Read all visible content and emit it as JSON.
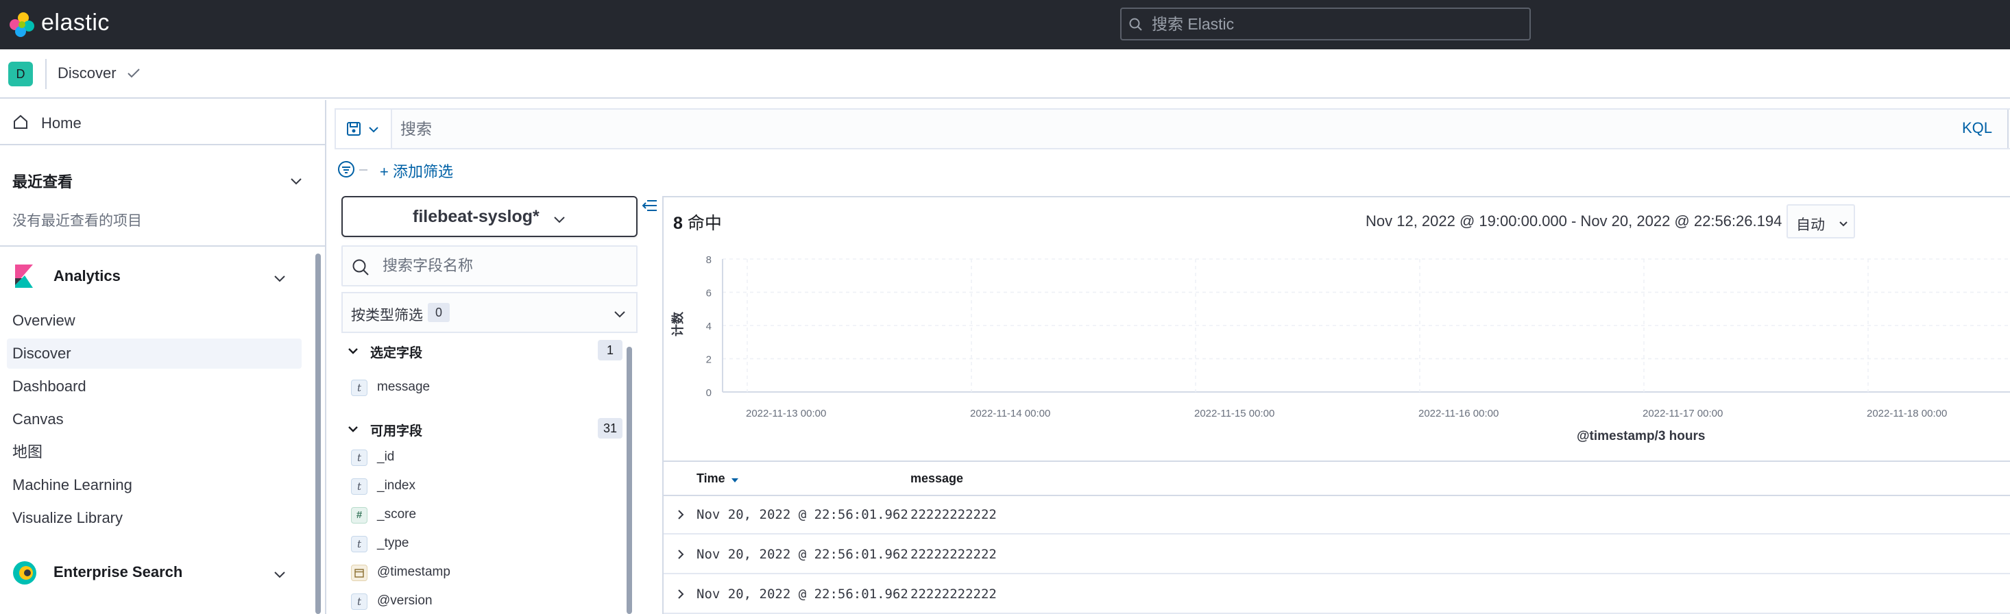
{
  "header": {
    "brand": "elastic",
    "search_placeholder": "搜索 Elastic"
  },
  "breadcrumb": {
    "space_initial": "D",
    "current": "Discover"
  },
  "sidenav": {
    "home_label": "Home",
    "recent_title": "最近查看",
    "recent_empty": "没有最近查看的项目",
    "analytics": {
      "title": "Analytics",
      "items": [
        {
          "label": "Overview",
          "active": false
        },
        {
          "label": "Discover",
          "active": true
        },
        {
          "label": "Dashboard",
          "active": false
        },
        {
          "label": "Canvas",
          "active": false
        },
        {
          "label": "地图",
          "active": false
        },
        {
          "label": "Machine Learning",
          "active": false
        },
        {
          "label": "Visualize Library",
          "active": false
        }
      ]
    },
    "enterprise": {
      "title": "Enterprise Search"
    }
  },
  "querybar": {
    "placeholder": "搜索",
    "language": "KQL",
    "add_filter": "+ 添加筛选"
  },
  "fields": {
    "index_pattern": "filebeat-syslog*",
    "search_placeholder": "搜索字段名称",
    "type_filter_label": "按类型筛选",
    "type_filter_count": "0",
    "selected_title": "选定字段",
    "selected_count": "1",
    "selected": [
      {
        "type": "t",
        "name": "message"
      }
    ],
    "available_title": "可用字段",
    "available_count": "31",
    "available": [
      {
        "type": "t",
        "name": "_id"
      },
      {
        "type": "t",
        "name": "_index"
      },
      {
        "type": "#",
        "name": "_score"
      },
      {
        "type": "t",
        "name": "_type"
      },
      {
        "type": "date",
        "name": "@timestamp"
      },
      {
        "type": "t",
        "name": "@version"
      }
    ]
  },
  "results": {
    "hits_count": "8",
    "hits_label": "命中",
    "time_range": "Nov 12, 2022 @ 19:00:00.000 - Nov 20, 2022 @ 22:56:26.194",
    "interval": "自动"
  },
  "chart_data": {
    "type": "bar",
    "ylabel": "计数",
    "xlabel": "@timestamp/3 hours",
    "ylim": [
      0,
      8
    ],
    "yticks": [
      "0",
      "2",
      "4",
      "6",
      "8"
    ],
    "categories": [
      "2022-11-13 00:00",
      "2022-11-14 00:00",
      "2022-11-15 00:00",
      "2022-11-16 00:00",
      "2022-11-17 00:00",
      "2022-11-18 00:00"
    ],
    "values": [
      0,
      0,
      0,
      0,
      0,
      0
    ],
    "grid": true
  },
  "table": {
    "col_time": "Time",
    "col_message": "message",
    "rows": [
      {
        "time": "Nov 20, 2022 @ 22:56:01.962",
        "message": "22222222222"
      },
      {
        "time": "Nov 20, 2022 @ 22:56:01.962",
        "message": "22222222222"
      },
      {
        "time": "Nov 20, 2022 @ 22:56:01.962",
        "message": "22222222222"
      }
    ]
  }
}
